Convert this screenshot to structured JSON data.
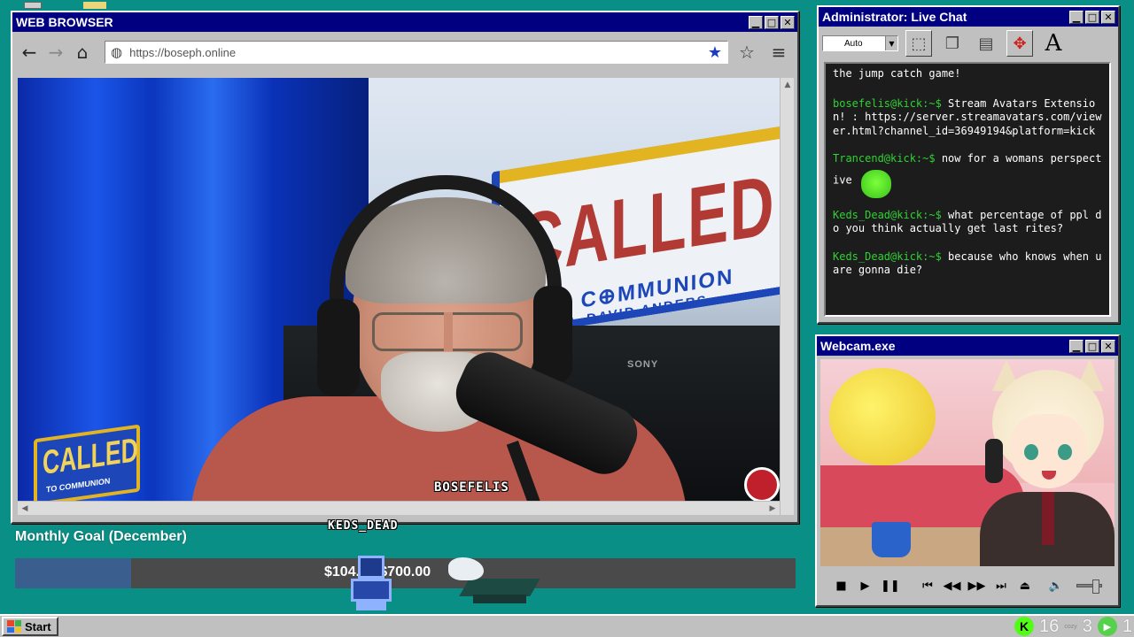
{
  "browser": {
    "title": "WEB BROWSER",
    "url": "https://boseph.online",
    "minimize": "▁",
    "maximize": "□",
    "close": "✕",
    "back_icon": "arrow-left",
    "forward_icon": "arrow-right",
    "home_icon": "home",
    "globe_icon": "globe",
    "bookmark_icon": "star-filled",
    "star_icon": "star-outline",
    "menu_icon": "hamburger"
  },
  "video": {
    "overlay_username": "BOSEFELIS",
    "sign_main": "CALLED",
    "sign_sub": "TO C⊕MMUNION",
    "sign_sub2": "DR. DAVID ANDERS",
    "sign_brand": "SONY",
    "logo_main": "CALLED",
    "logo_sub": "TO COMMUNION"
  },
  "chat": {
    "title": "Administrator: Live Chat",
    "select_value": "Auto",
    "messages": [
      {
        "user": "",
        "text": "the jump catch game!"
      },
      {
        "user": "bosefelis@kick:~$",
        "text": " Stream Avatars Extension! : https://server.streamavatars.com/viewer.html?channel_id=36949194&platform=kick"
      },
      {
        "user": "Trancend@kick:~$",
        "text": " now for a womans perspective"
      },
      {
        "user": "Keds_Dead@kick:~$",
        "text": " what percentage of ppl do you think actually get last rites?"
      },
      {
        "user": "Keds_Dead@kick:~$",
        "text": " because who knows when u are gonna die?"
      }
    ]
  },
  "webcam": {
    "title": "Webcam.exe"
  },
  "goal": {
    "title": "Monthly Goal (December)",
    "text": "$104.00/$700.00",
    "progress_fraction": 0.149,
    "sprite_name": "KEDS_DEAD"
  },
  "taskbar": {
    "start_label": "Start",
    "kick_label": "K",
    "count1": "16",
    "cozy": "cozy",
    "count2": "3",
    "count3": "1"
  },
  "colors": {
    "desktop": "#0a8f86",
    "titlebar": "#000080",
    "chat_username": "#2fd233",
    "goal_fill": "#3a5e8e"
  }
}
